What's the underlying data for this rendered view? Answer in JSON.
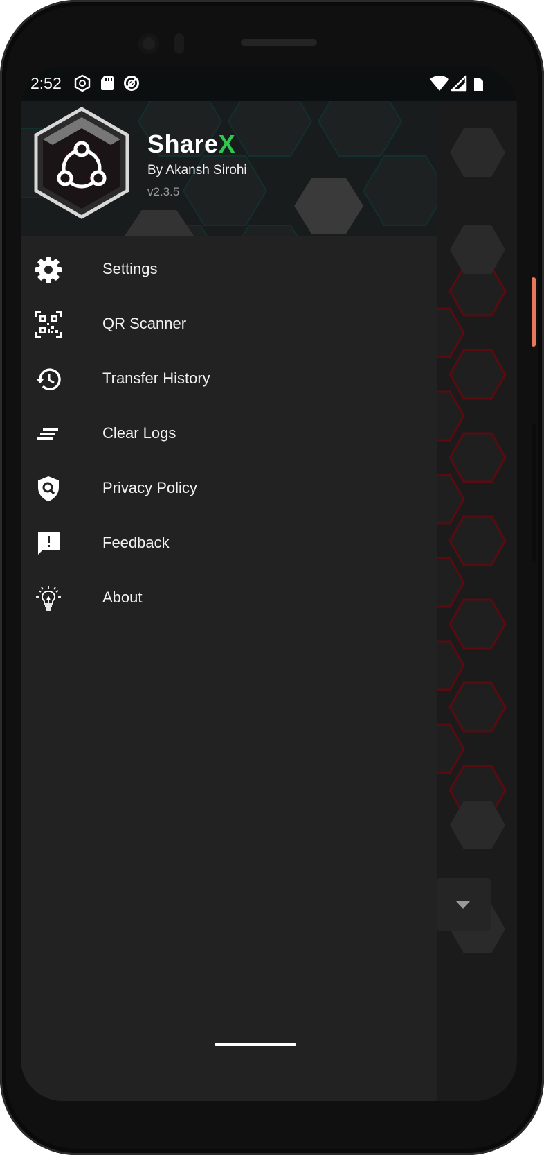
{
  "status_bar": {
    "time": "2:52",
    "left_icons": [
      "app-notification-icon",
      "sd-card-icon",
      "data-saver-icon"
    ],
    "right_icons": [
      "wifi-icon",
      "cell-signal-icon",
      "battery-icon"
    ]
  },
  "drawer": {
    "header": {
      "title_main": "Share",
      "title_accent": "X",
      "author": "By Akansh Sirohi",
      "version": "v2.3.5"
    },
    "items": [
      {
        "label": "Settings",
        "icon": "gear-icon"
      },
      {
        "label": "QR Scanner",
        "icon": "qr-code-icon"
      },
      {
        "label": "Transfer History",
        "icon": "history-icon"
      },
      {
        "label": "Clear Logs",
        "icon": "clear-all-icon"
      },
      {
        "label": "Privacy Policy",
        "icon": "shield-search-icon"
      },
      {
        "label": "Feedback",
        "icon": "feedback-icon"
      },
      {
        "label": "About",
        "icon": "lightbulb-icon"
      }
    ]
  },
  "colors": {
    "accent": "#2dc84d",
    "drawer_background": "#222222",
    "hex_glow": "#8b0f15"
  }
}
